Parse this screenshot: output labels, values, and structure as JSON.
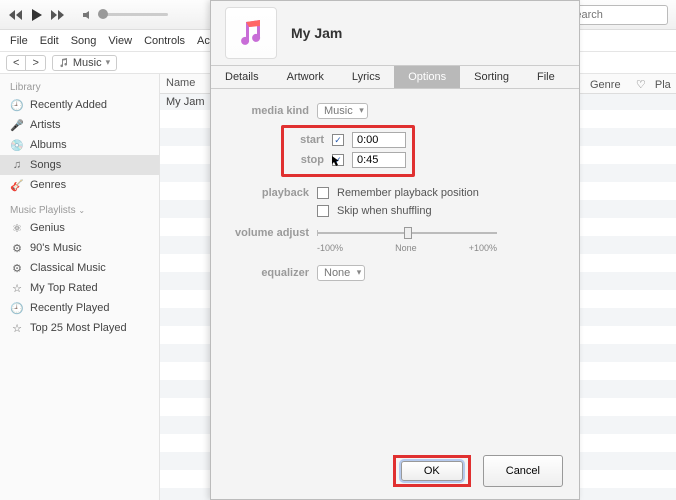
{
  "topbar": {
    "search_placeholder": "Search"
  },
  "menu": [
    "File",
    "Edit",
    "Song",
    "View",
    "Controls",
    "Account"
  ],
  "toolbar": {
    "picker_label": "Music"
  },
  "sidebar": {
    "section_library": "Library",
    "library_items": [
      "Recently Added",
      "Artists",
      "Albums",
      "Songs",
      "Genres"
    ],
    "selected_library_index": 3,
    "section_playlists": "Music Playlists",
    "playlist_items": [
      "Genius",
      "90's Music",
      "Classical Music",
      "My Top Rated",
      "Recently Played",
      "Top 25 Most Played"
    ]
  },
  "list": {
    "col_name": "Name",
    "col_genre": "Genre",
    "col_pla": "Pla",
    "row0_name": "My Jam"
  },
  "dialog": {
    "title": "My Jam",
    "tabs": [
      "Details",
      "Artwork",
      "Lyrics",
      "Options",
      "Sorting",
      "File"
    ],
    "active_tab_index": 3,
    "media_kind_label": "media kind",
    "media_kind_value": "Music",
    "start_label": "start",
    "start_value": "0:00",
    "start_checked": true,
    "stop_label": "stop",
    "stop_value": "0:45",
    "stop_checked": true,
    "playback_label": "playback",
    "remember_label": "Remember playback position",
    "skip_label": "Skip when shuffling",
    "volume_label": "volume adjust",
    "vol_min": "-100%",
    "vol_mid": "None",
    "vol_max": "+100%",
    "equalizer_label": "equalizer",
    "equalizer_value": "None",
    "ok": "OK",
    "cancel": "Cancel"
  }
}
